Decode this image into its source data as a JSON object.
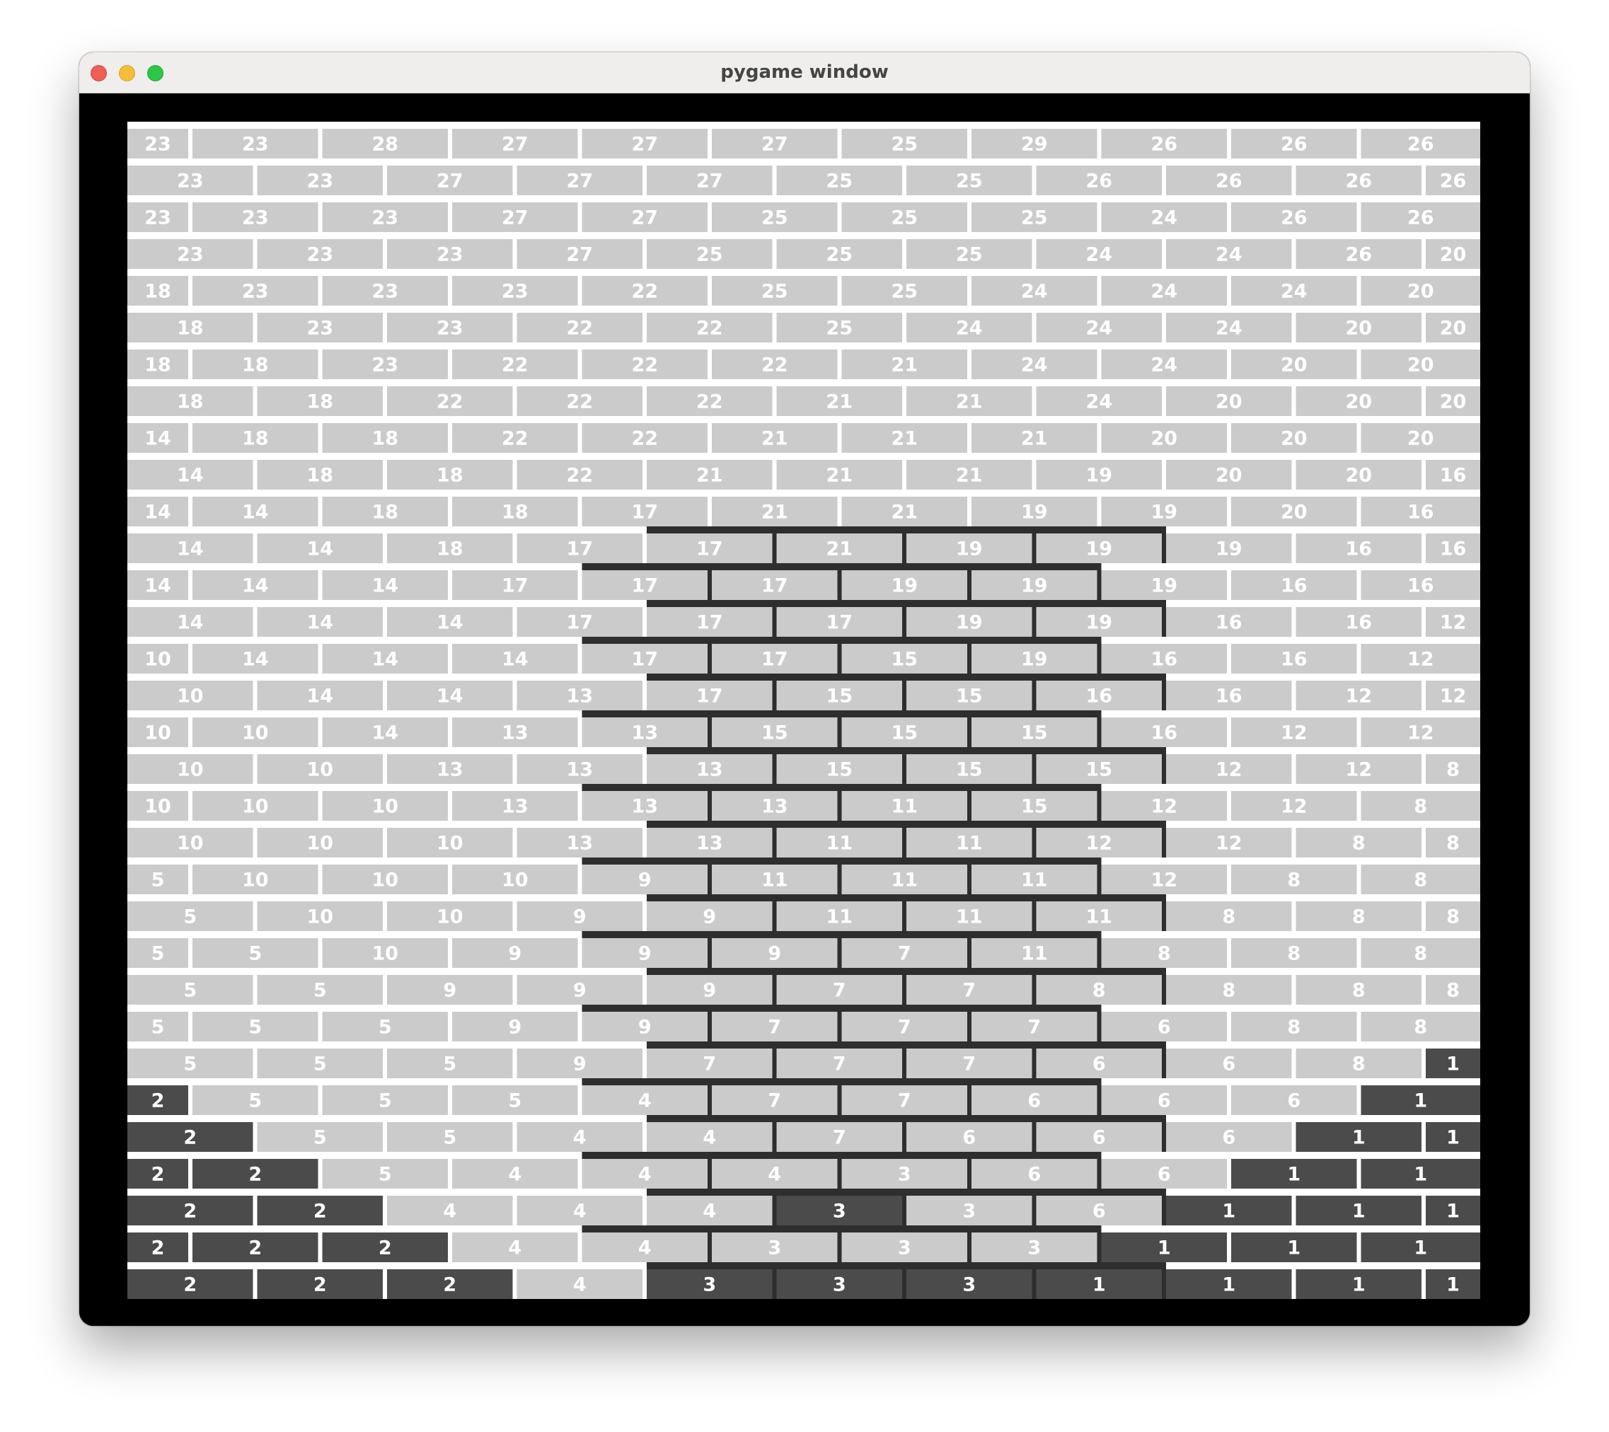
{
  "window": {
    "title": "pygame window",
    "controls": [
      "close",
      "minimize",
      "zoom"
    ]
  },
  "colors": {
    "light_brick": "#cbcbcb",
    "dark_brick": "#4b4b4b",
    "frame_line": "#2e2e2e",
    "mortar": "#ffffff",
    "border": "#000000"
  },
  "board": {
    "rows": [
      [
        "23",
        "23",
        "28",
        "27",
        "27",
        "27",
        "25",
        "29",
        "26",
        "26",
        "26"
      ],
      [
        "23",
        "23",
        "27",
        "27",
        "27",
        "25",
        "25",
        "26",
        "26",
        "26",
        "26"
      ],
      [
        "23",
        "23",
        "23",
        "27",
        "27",
        "25",
        "25",
        "25",
        "24",
        "26",
        "26"
      ],
      [
        "23",
        "23",
        "23",
        "27",
        "25",
        "25",
        "25",
        "24",
        "24",
        "26",
        "20"
      ],
      [
        "18",
        "23",
        "23",
        "23",
        "22",
        "25",
        "25",
        "24",
        "24",
        "24",
        "20"
      ],
      [
        "18",
        "23",
        "23",
        "22",
        "22",
        "25",
        "24",
        "24",
        "24",
        "20",
        "20"
      ],
      [
        "18",
        "18",
        "23",
        "22",
        "22",
        "22",
        "21",
        "24",
        "24",
        "20",
        "20"
      ],
      [
        "18",
        "18",
        "22",
        "22",
        "22",
        "21",
        "21",
        "24",
        "20",
        "20",
        "20"
      ],
      [
        "14",
        "18",
        "18",
        "22",
        "22",
        "21",
        "21",
        "21",
        "20",
        "20",
        "20"
      ],
      [
        "14",
        "18",
        "18",
        "22",
        "21",
        "21",
        "21",
        "19",
        "20",
        "20",
        "16"
      ],
      [
        "14",
        "14",
        "18",
        "18",
        "17",
        "21",
        "21",
        "19",
        "19",
        "20",
        "16"
      ],
      [
        "14",
        "14",
        "18",
        "17",
        "17",
        "21",
        "19",
        "19",
        "19",
        "16",
        "16"
      ],
      [
        "14",
        "14",
        "14",
        "17",
        "17",
        "17",
        "19",
        "19",
        "19",
        "16",
        "16"
      ],
      [
        "14",
        "14",
        "14",
        "17",
        "17",
        "17",
        "19",
        "19",
        "16",
        "16",
        "12"
      ],
      [
        "10",
        "14",
        "14",
        "14",
        "17",
        "17",
        "15",
        "19",
        "16",
        "16",
        "12"
      ],
      [
        "10",
        "14",
        "14",
        "13",
        "17",
        "15",
        "15",
        "16",
        "16",
        "12",
        "12"
      ],
      [
        "10",
        "10",
        "14",
        "13",
        "13",
        "15",
        "15",
        "15",
        "16",
        "12",
        "12"
      ],
      [
        "10",
        "10",
        "13",
        "13",
        "13",
        "15",
        "15",
        "15",
        "12",
        "12",
        "8"
      ],
      [
        "10",
        "10",
        "10",
        "13",
        "13",
        "13",
        "11",
        "15",
        "12",
        "12",
        "8"
      ],
      [
        "10",
        "10",
        "10",
        "13",
        "13",
        "11",
        "11",
        "12",
        "12",
        "8",
        "8"
      ],
      [
        "5",
        "10",
        "10",
        "10",
        "9",
        "11",
        "11",
        "11",
        "12",
        "8",
        "8"
      ],
      [
        "5",
        "10",
        "10",
        "9",
        "9",
        "11",
        "11",
        "11",
        "8",
        "8",
        "8"
      ],
      [
        "5",
        "5",
        "10",
        "9",
        "9",
        "9",
        "7",
        "11",
        "8",
        "8",
        "8"
      ],
      [
        "5",
        "5",
        "9",
        "9",
        "9",
        "7",
        "7",
        "8",
        "8",
        "8",
        "8"
      ],
      [
        "5",
        "5",
        "5",
        "9",
        "9",
        "7",
        "7",
        "7",
        "6",
        "8",
        "8"
      ],
      [
        "5",
        "5",
        "5",
        "9",
        "7",
        "7",
        "7",
        "6",
        "6",
        "8",
        "1"
      ],
      [
        "2",
        "5",
        "5",
        "5",
        "4",
        "7",
        "7",
        "6",
        "6",
        "6",
        "1"
      ],
      [
        "2",
        "5",
        "5",
        "4",
        "4",
        "7",
        "6",
        "6",
        "6",
        "1",
        "1"
      ],
      [
        "2",
        "2",
        "5",
        "4",
        "4",
        "4",
        "3",
        "6",
        "6",
        "1",
        "1"
      ],
      [
        "2",
        "2",
        "4",
        "4",
        "4",
        "3",
        "3",
        "6",
        "1",
        "1",
        "1"
      ],
      [
        "2",
        "2",
        "2",
        "4",
        "4",
        "3",
        "3",
        "3",
        "1",
        "1",
        "1"
      ],
      [
        "2",
        "2",
        "2",
        "4",
        "3",
        "3",
        "3",
        "1",
        "1",
        "1",
        "1"
      ]
    ],
    "dark_values": [
      "1",
      "2",
      "3"
    ],
    "dark_cells_in_frame": [
      [
        29,
        5
      ],
      [
        29,
        7
      ]
    ],
    "highlight_frame": {
      "row_start": 11,
      "col_start": 4,
      "col_end": 7
    }
  }
}
